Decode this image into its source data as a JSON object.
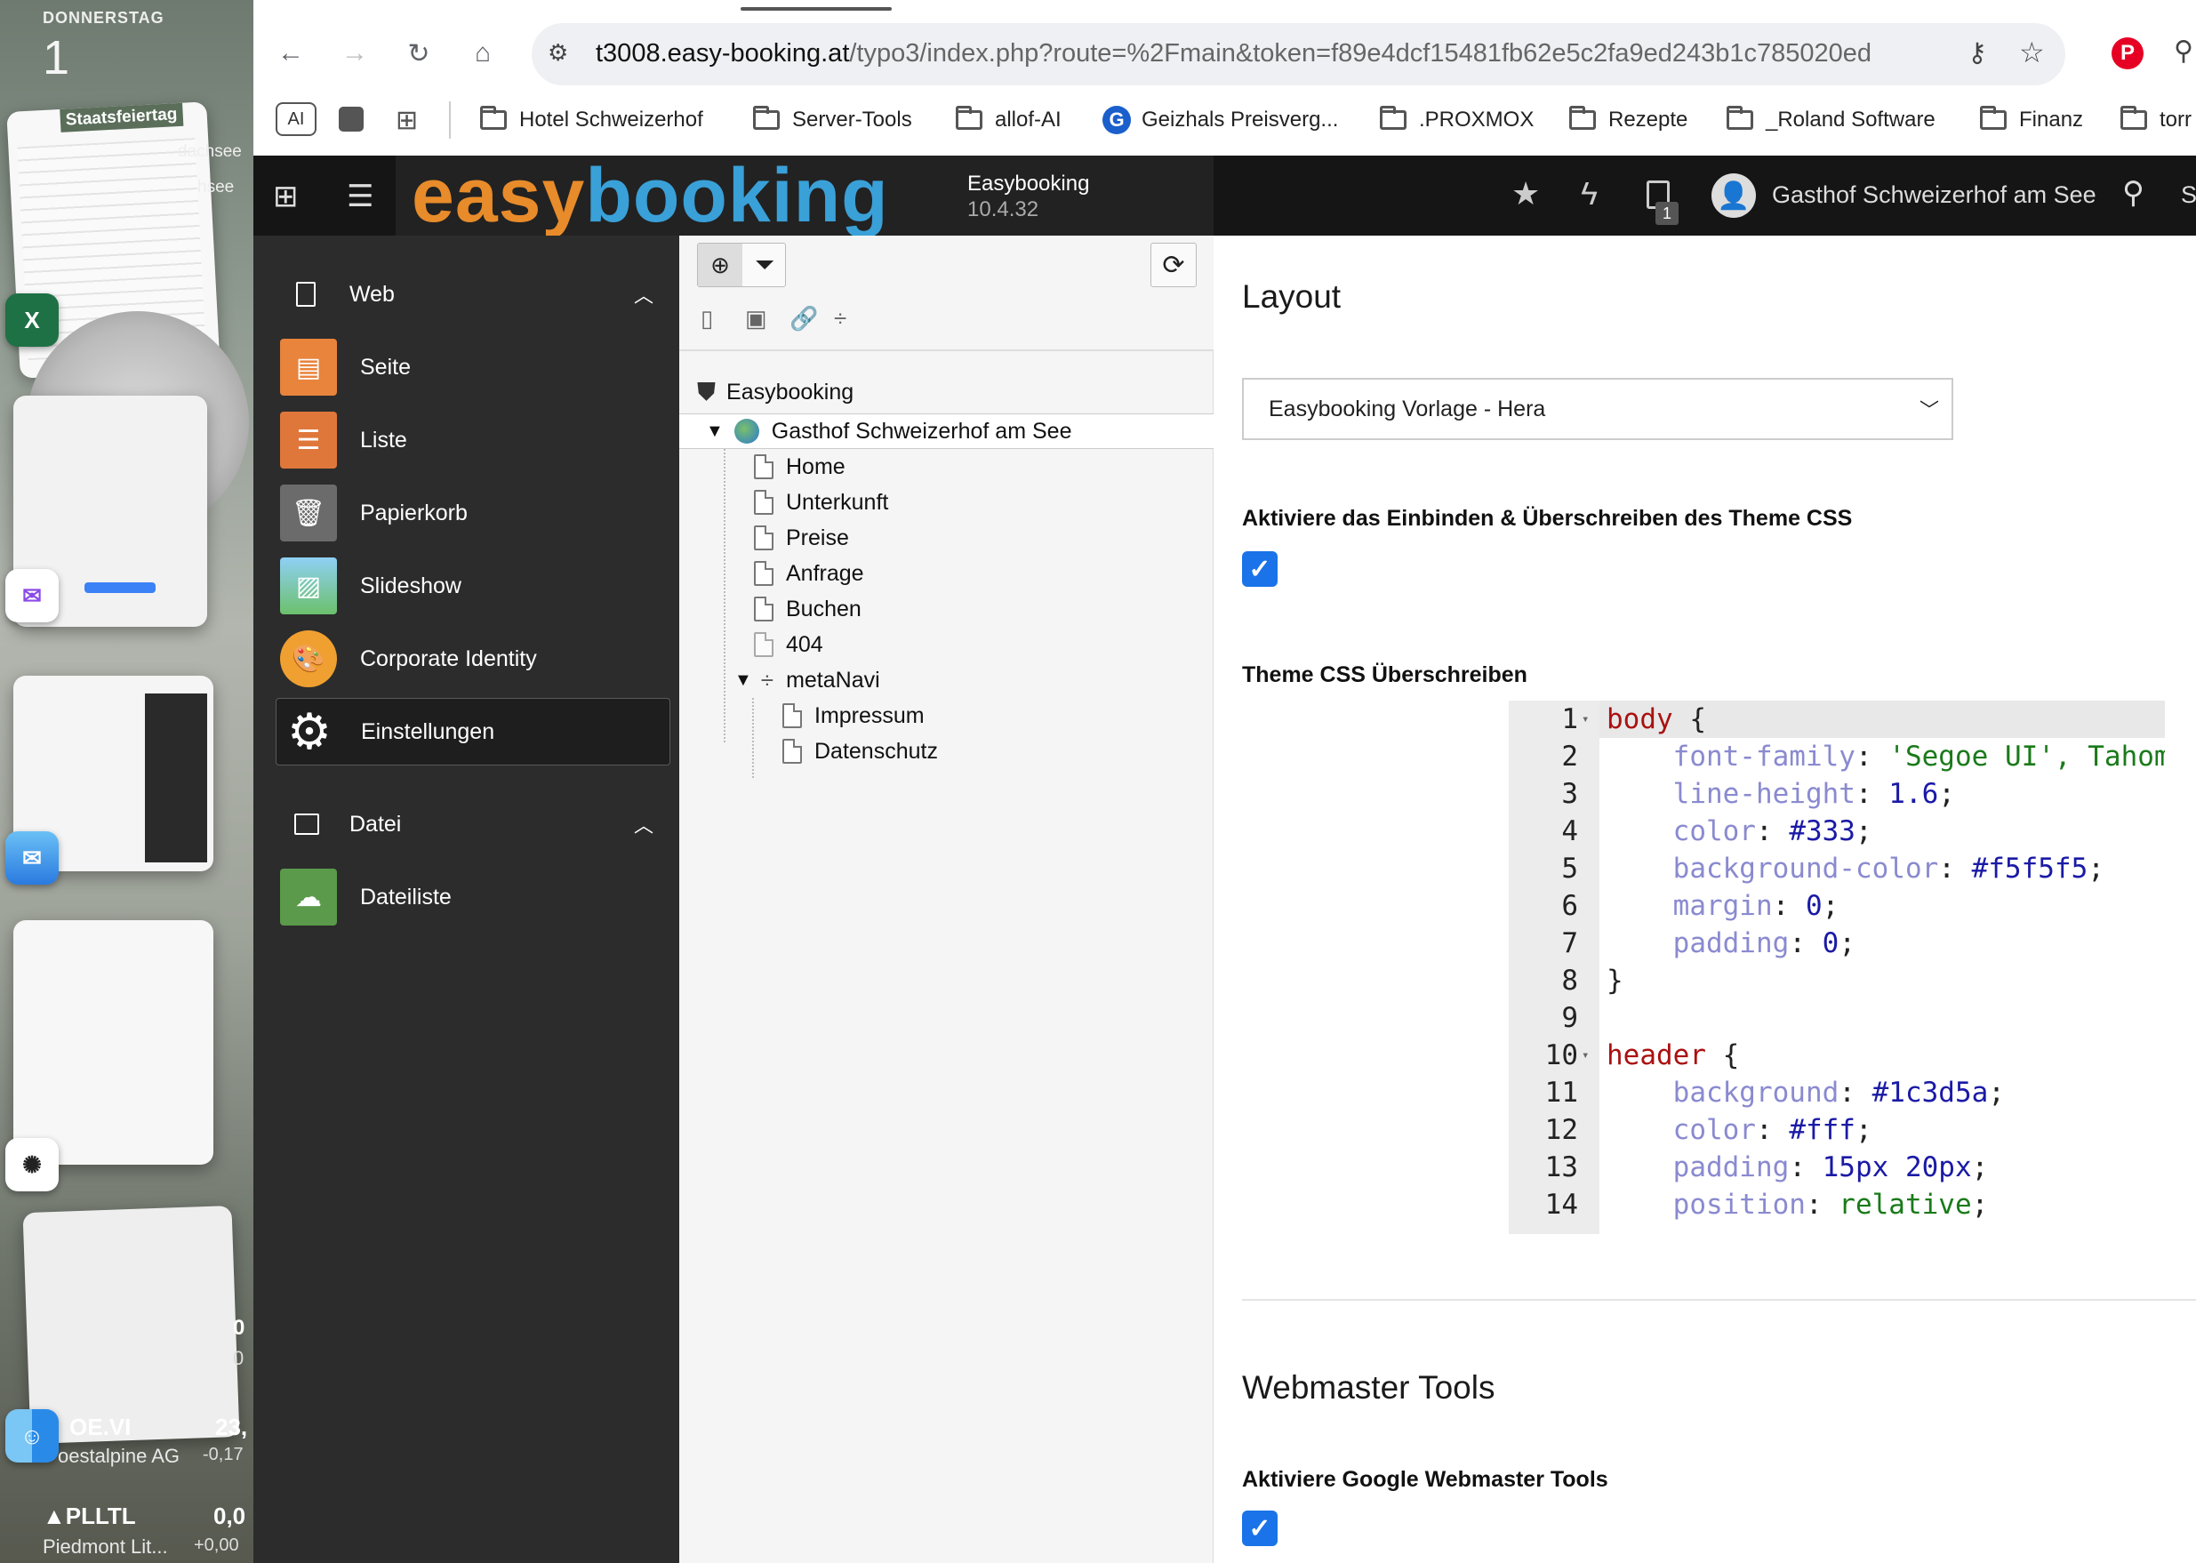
{
  "desktop": {
    "day_label": "DONNERSTAG",
    "day_number": "1",
    "holiday": "Staatsfeiertag",
    "calendar_snippet_1": "dachsee",
    "calendar_snippet_2": "hsee",
    "stocks": [
      {
        "symbol": "OE.VI",
        "name": "oestalpine AG",
        "value": "23,",
        "change": "-0,17"
      },
      {
        "symbol": "▲PLLTL",
        "name": "Piedmont Lit...",
        "value": "0,0",
        "change": "+0,00"
      }
    ],
    "stock_partial_1": "0",
    "stock_partial_2": "0"
  },
  "browser": {
    "url_host": "t3008.easy-booking.at",
    "url_path": "/typo3/index.php?route=%2Fmain&token=f89e4dcf15481fb62e5c2fa9ed243b1c785020ed",
    "bookmarks": [
      {
        "label": "Hotel Schweizerhof",
        "icon": "folder-icon"
      },
      {
        "label": "Server-Tools",
        "icon": "folder-icon"
      },
      {
        "label": "allof-AI",
        "icon": "folder-icon"
      },
      {
        "label": "Geizhals Preisverg...",
        "icon": "geizhals-icon"
      },
      {
        "label": ".PROXMOX",
        "icon": "folder-icon"
      },
      {
        "label": "Rezepte",
        "icon": "folder-icon"
      },
      {
        "label": "_Roland Software",
        "icon": "folder-icon"
      },
      {
        "label": "Finanz",
        "icon": "folder-icon"
      },
      {
        "label": "torr",
        "icon": "folder-icon"
      }
    ],
    "ai_badge": "AI"
  },
  "topbar": {
    "logo_easy": "easy",
    "logo_booking": "booking",
    "app_name": "Easybooking",
    "version": "10.4.32",
    "notification_count": "1",
    "user_name": "Gasthof Schweizerhof am See",
    "search_partial": "S"
  },
  "sidebar": {
    "web_section": "Web",
    "web_items": [
      {
        "label": "Seite",
        "color": "#e8843c"
      },
      {
        "label": "Liste",
        "color": "#e0773a"
      },
      {
        "label": "Papierkorb",
        "color": "#6b6b6b"
      },
      {
        "label": "Slideshow",
        "color": "#4aa0d8"
      },
      {
        "label": "Corporate Identity",
        "color": "#f0a030"
      },
      {
        "label": "Einstellungen",
        "color": "#ffffff"
      }
    ],
    "file_section": "Datei",
    "file_items": [
      {
        "label": "Dateiliste",
        "color": "#5a9a4a"
      }
    ]
  },
  "tree": {
    "root": "Easybooking",
    "site": "Gasthof Schweizerhof am See",
    "pages": [
      "Home",
      "Unterkunft",
      "Preise",
      "Anfrage",
      "Buchen",
      "404"
    ],
    "folder": "metaNavi",
    "sub_pages": [
      "Impressum",
      "Datenschutz"
    ]
  },
  "content": {
    "layout_heading": "Layout",
    "layout_select": "Easybooking Vorlage - Hera",
    "css_checkbox_label": "Aktiviere das Einbinden & Überschreiben des Theme CSS",
    "css_override_label": "Theme CSS Überschreiben",
    "webmaster_heading": "Webmaster Tools",
    "webmaster_label": "Aktiviere Google Webmaster Tools"
  },
  "code_lines": [
    {
      "n": "1",
      "sel": "body",
      "rest": " {"
    },
    {
      "n": "2",
      "prop": "font-family",
      "val": "'Segoe UI', Tahoma",
      "kind": "str"
    },
    {
      "n": "3",
      "prop": "line-height",
      "val": "1.6;",
      "kind": "val"
    },
    {
      "n": "4",
      "prop": "color",
      "val": "#333;",
      "kind": "val"
    },
    {
      "n": "5",
      "prop": "background-color",
      "val": "#f5f5f5;",
      "kind": "val"
    },
    {
      "n": "6",
      "prop": "margin",
      "val": "0;",
      "kind": "val"
    },
    {
      "n": "7",
      "prop": "padding",
      "val": "0;",
      "kind": "val"
    },
    {
      "n": "8",
      "rest": "}"
    },
    {
      "n": "9",
      "rest": ""
    },
    {
      "n": "10",
      "sel": "header",
      "rest": " {"
    },
    {
      "n": "11",
      "prop": "background",
      "val": "#1c3d5a;",
      "kind": "val"
    },
    {
      "n": "12",
      "prop": "color",
      "val": "#fff;",
      "kind": "val"
    },
    {
      "n": "13",
      "prop": "padding",
      "val": "15px 20px;",
      "kind": "val"
    },
    {
      "n": "14",
      "prop": "position",
      "val": "relative;",
      "kind": "str"
    }
  ]
}
